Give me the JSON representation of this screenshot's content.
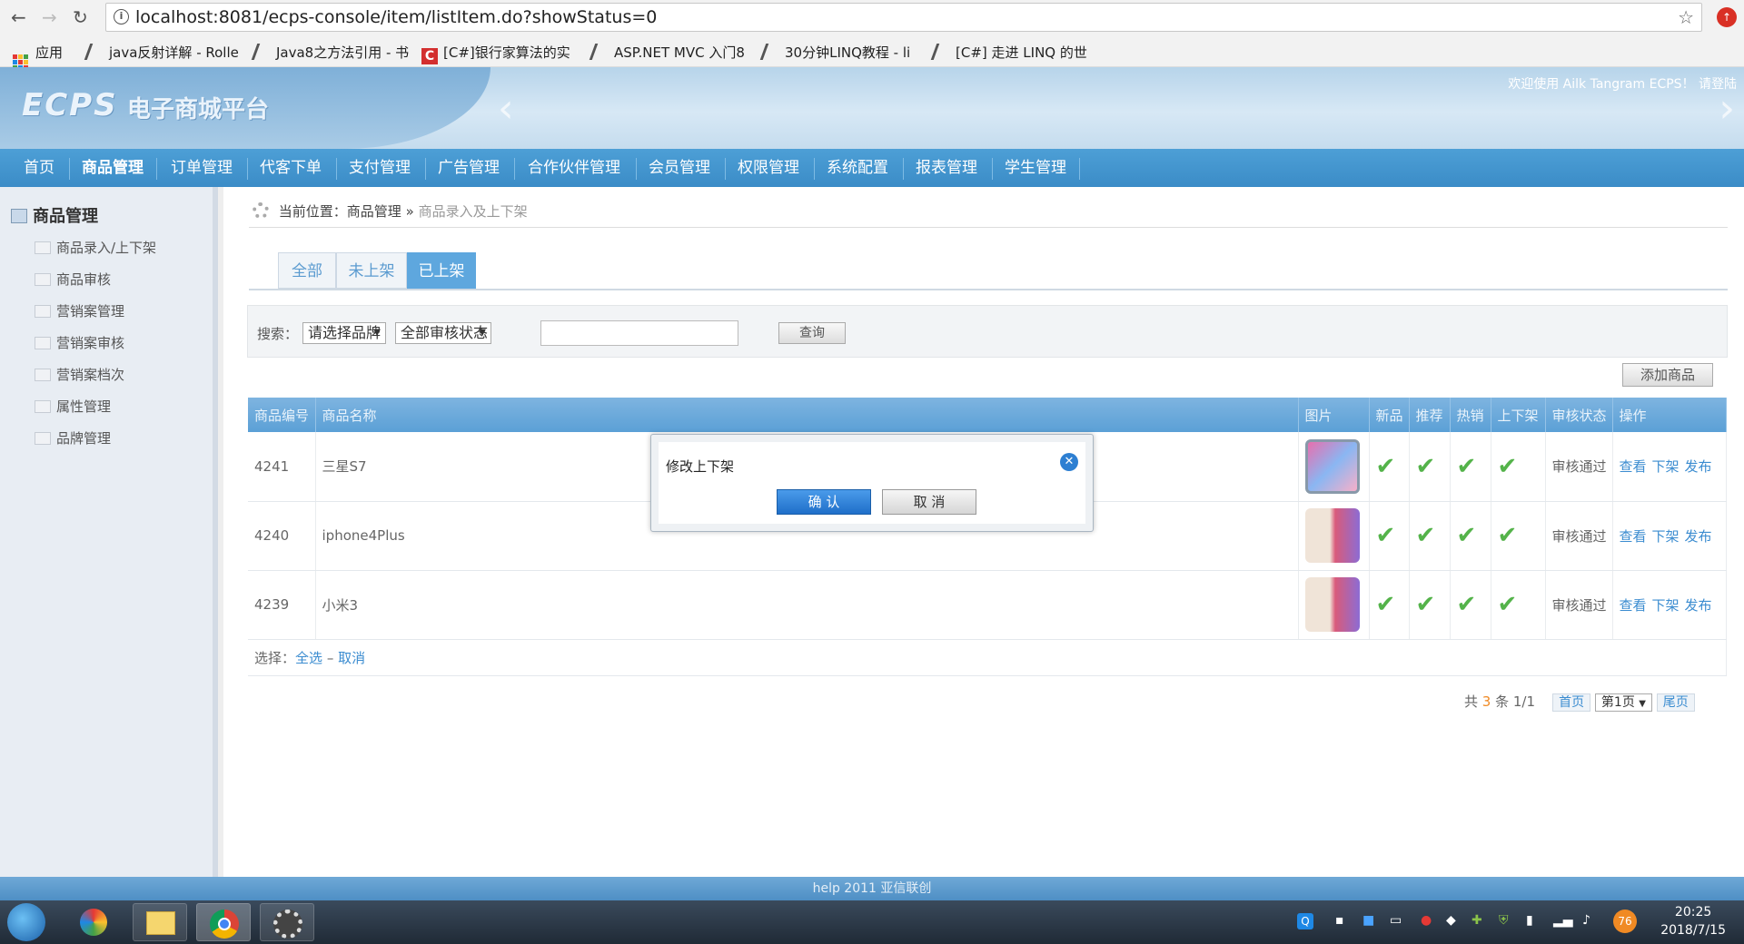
{
  "browser": {
    "url": "localhost:8081/ecps-console/item/listItem.do?showStatus=0"
  },
  "bookmarks": [
    {
      "label": "应用"
    },
    {
      "label": "java反射详解 - Rolle"
    },
    {
      "label": "Java8之方法引用 - 书"
    },
    {
      "label": "[C#]银行家算法的实"
    },
    {
      "label": "ASP.NET MVC 入门8"
    },
    {
      "label": "30分钟LINQ教程 - li"
    },
    {
      "label": "[C#] 走进 LINQ 的世"
    }
  ],
  "header": {
    "logo": "ECPS",
    "subtitle": "电子商城平台",
    "welcome": "欢迎使用 Ailk Tangram ECPS！ 请登陆"
  },
  "nav": [
    "首页",
    "商品管理",
    "订单管理",
    "代客下单",
    "支付管理",
    "广告管理",
    "合作伙伴管理",
    "会员管理",
    "权限管理",
    "系统配置",
    "报表管理",
    "学生管理"
  ],
  "sidebar": {
    "title": "商品管理",
    "items": [
      "商品录入/上下架",
      "商品审核",
      "营销案管理",
      "营销案审核",
      "营销案档次",
      "属性管理",
      "品牌管理"
    ]
  },
  "breadcrumb": {
    "prefix": "当前位置：",
    "section": "商品管理",
    "sep": "»",
    "current": "商品录入及上下架"
  },
  "tabs": [
    "全部",
    "未上架",
    "已上架"
  ],
  "search": {
    "label": "搜索：",
    "brand": "请选择品牌",
    "status": "全部审核状态",
    "query_button": "查询"
  },
  "add_button": "添加商品",
  "table": {
    "headers": [
      "商品编号",
      "商品名称",
      "图片",
      "新品",
      "推荐",
      "热销",
      "上下架",
      "审核状态",
      "操作"
    ],
    "rows": [
      {
        "id": "4241",
        "name": "三星S7",
        "status": "审核通过"
      },
      {
        "id": "4240",
        "name": "iphone4Plus",
        "status": "审核通过"
      },
      {
        "id": "4239",
        "name": "小米3",
        "status": "审核通过"
      }
    ],
    "ops": [
      "查看",
      "下架",
      "发布"
    ],
    "select": {
      "label": "选择：",
      "all": "全选",
      "sep": "–",
      "none": "取消"
    }
  },
  "pager": {
    "total_prefix": "共",
    "total": "3",
    "total_suffix": "条 1/1",
    "first": "首页",
    "page": "第1页",
    "last": "尾页"
  },
  "dialog": {
    "title": "修改上下架",
    "ok": "确 认",
    "cancel": "取 消"
  },
  "footer": "help 2011 亚信联创",
  "taskbar": {
    "time": "20:25",
    "date": "2018/7/15",
    "badge": "76"
  }
}
